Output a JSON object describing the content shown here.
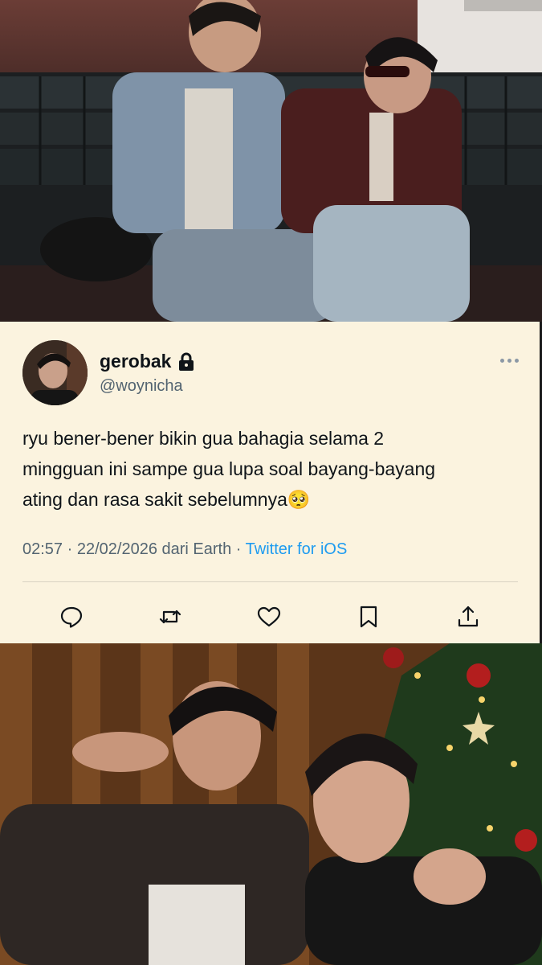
{
  "tweet": {
    "display_name": "gerobak",
    "handle": "@woynicha",
    "text": "ryu bener-bener bikin gua bahagia selama 2\nmingguan ini sampe gua lupa soal bayang-bayang\nating dan rasa sakit sebelumnya🥺",
    "time": "02:57",
    "separator": " · ",
    "date": "22/02/2026",
    "location": " dari Earth",
    "source": "Twitter for iOS"
  },
  "icons": {
    "lock": "lock-icon",
    "more": "more-icon",
    "reply": "reply-icon",
    "retweet": "retweet-icon",
    "like": "like-icon",
    "bookmark": "bookmark-icon",
    "share": "share-icon"
  },
  "colors": {
    "card_background": "#fbf3df",
    "primary_text": "#0f1419",
    "secondary_text": "#536471",
    "link": "#1d9bf0"
  }
}
